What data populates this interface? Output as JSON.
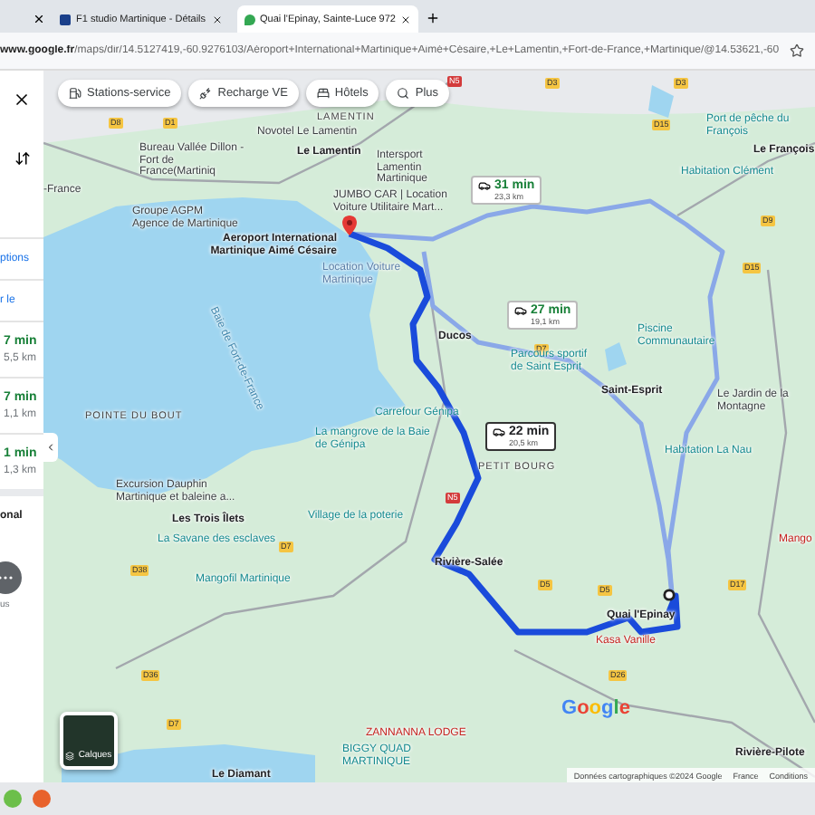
{
  "browser": {
    "tabs": [
      {
        "title": "F1 studio Martinique - Détails",
        "selected": false
      },
      {
        "title": "Quai l'Epinay, Sainte-Luce 972",
        "selected": true
      }
    ],
    "url": "**www.google.fr**/maps/dir/14.5127419,-60.9276103/Aéroport+International+Martinique+Aimé+Césaire,+Le+Lamentin,+Fort-de-France,+Martinique/@14.53621,-60"
  },
  "sidebar": {
    "links": [
      "ptions",
      "r le"
    ],
    "routes": [
      {
        "time": "7 min",
        "distance": "5,5 km"
      },
      {
        "time": "7 min",
        "distance": "1,1 km"
      },
      {
        "time": "1 min",
        "distance": "1,3 km"
      }
    ],
    "label": "onal",
    "more_label": "us"
  },
  "map": {
    "chips": [
      {
        "label": "Stations-service",
        "kind": "fuel"
      },
      {
        "label": "Recharge VE",
        "kind": "charge"
      },
      {
        "label": "Hôtels",
        "kind": "hotel"
      },
      {
        "label": "Plus",
        "kind": "search"
      }
    ],
    "places": [
      {
        "name": "LAMENTIN",
        "kind": "locality"
      },
      {
        "name": "Novotel Le Lamentin",
        "kind": "place"
      },
      {
        "name": "Port de pêche du François",
        "kind": "poi"
      },
      {
        "name": "Bureau Vallée Dillon - Fort de France(Martiniq",
        "kind": "place"
      },
      {
        "name": "Le Lamentin",
        "kind": "town"
      },
      {
        "name": "Intersport Lamentin Martinique",
        "kind": "place"
      },
      {
        "name": "Le François",
        "kind": "town"
      },
      {
        "name": "Habitation Clément",
        "kind": "poi"
      },
      {
        "name": "-France",
        "kind": "place"
      },
      {
        "name": "Groupe AGPM Agence de Martinique",
        "kind": "place"
      },
      {
        "name": "JUMBO CAR | Location Voiture Utilitaire Mart...",
        "kind": "place"
      },
      {
        "name": "Aeroport International Martinique Aimé Césaire",
        "kind": "airport"
      },
      {
        "name": "Location Voiture Martinique",
        "kind": "muted"
      },
      {
        "name": "Baie de Fort-de-France",
        "kind": "water"
      },
      {
        "name": "Ducos",
        "kind": "town"
      },
      {
        "name": "Piscine Communautaire",
        "kind": "poi"
      },
      {
        "name": "Parcours sportif de Saint Esprit",
        "kind": "poi"
      },
      {
        "name": "Saint-Esprit",
        "kind": "town"
      },
      {
        "name": "POINTE DU BOUT",
        "kind": "locality"
      },
      {
        "name": "Carrefour Génipa",
        "kind": "poi"
      },
      {
        "name": "Le Jardin de la Montagne",
        "kind": "place"
      },
      {
        "name": "La mangrove de la Baie de Génipa",
        "kind": "poi"
      },
      {
        "name": "Habitation La Nau",
        "kind": "poi"
      },
      {
        "name": "PETIT BOURG",
        "kind": "locality"
      },
      {
        "name": "Excursion Dauphin Martinique et baleine a...",
        "kind": "place"
      },
      {
        "name": "Les Trois Îlets",
        "kind": "town"
      },
      {
        "name": "Village de la poterie",
        "kind": "poi"
      },
      {
        "name": "La Savane des esclaves",
        "kind": "poi"
      },
      {
        "name": "Mango",
        "kind": "food"
      },
      {
        "name": "Rivière-Salée",
        "kind": "town"
      },
      {
        "name": "Mangofil Martinique",
        "kind": "poi"
      },
      {
        "name": "Quai l'Epinay",
        "kind": "town"
      },
      {
        "name": "Kasa Vanille",
        "kind": "food"
      },
      {
        "name": "ZANNANNA LODGE",
        "kind": "food"
      },
      {
        "name": "BIGGY QUAD MARTINIQUE",
        "kind": "poi"
      },
      {
        "name": "Rivière-Pilote",
        "kind": "town"
      },
      {
        "name": "Le Diamant",
        "kind": "town"
      }
    ],
    "roads": [
      {
        "label": "N5",
        "kind": "national"
      },
      {
        "label": "D3",
        "kind": "departmental"
      },
      {
        "label": "D3",
        "kind": "departmental"
      },
      {
        "label": "D8",
        "kind": "departmental"
      },
      {
        "label": "D1",
        "kind": "departmental"
      },
      {
        "label": "D15",
        "kind": "departmental"
      },
      {
        "label": "D9",
        "kind": "departmental"
      },
      {
        "label": "D15",
        "kind": "departmental"
      },
      {
        "label": "D7",
        "kind": "departmental"
      },
      {
        "label": "D7",
        "kind": "departmental"
      },
      {
        "label": "D38",
        "kind": "departmental"
      },
      {
        "label": "D36",
        "kind": "departmental"
      },
      {
        "label": "D7",
        "kind": "departmental"
      },
      {
        "label": "D5",
        "kind": "departmental"
      },
      {
        "label": "D5",
        "kind": "departmental"
      },
      {
        "label": "N5",
        "kind": "national"
      },
      {
        "label": "D26",
        "kind": "departmental"
      },
      {
        "label": "D17",
        "kind": "departmental"
      }
    ],
    "routes": [
      {
        "time": "31 min",
        "distance": "23,3 km",
        "selected": false
      },
      {
        "time": "27 min",
        "distance": "19,1 km",
        "selected": false
      },
      {
        "time": "22 min",
        "distance": "20,5 km",
        "selected": true
      }
    ],
    "layers_button": "Calques",
    "logo": "Google",
    "footer": [
      "Données cartographiques ©2024 Google",
      "France",
      "Conditions"
    ]
  }
}
